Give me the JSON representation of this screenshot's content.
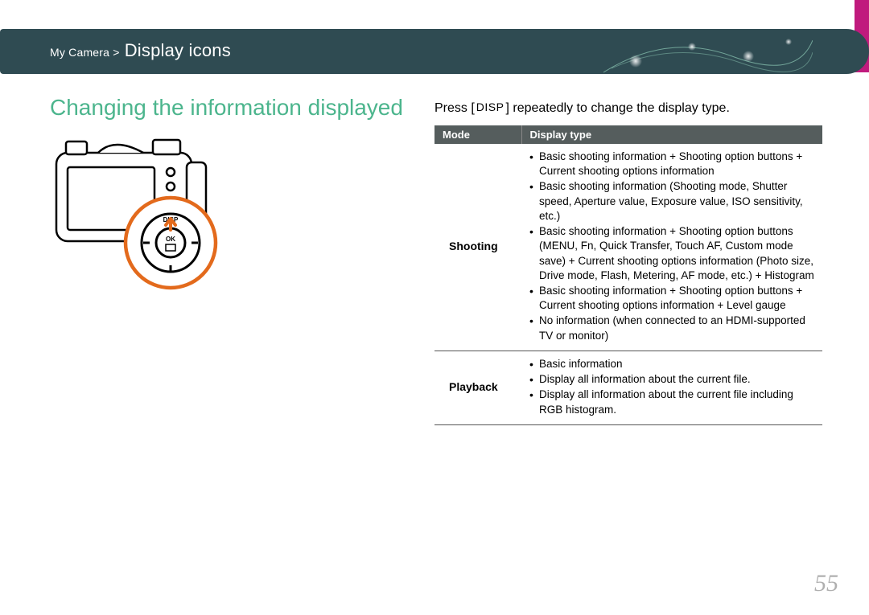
{
  "header": {
    "breadcrumb_prefix": "My Camera > ",
    "breadcrumb_current": "Display icons"
  },
  "section_title": "Changing the information displayed",
  "intro": {
    "prefix": "Press [",
    "button_label": "DISP",
    "suffix": "] repeatedly to change the display type."
  },
  "table": {
    "headers": {
      "mode": "Mode",
      "display_type": "Display type"
    },
    "rows": [
      {
        "mode": "Shooting",
        "items": [
          "Basic shooting information + Shooting option buttons + Current shooting options information",
          "Basic shooting information (Shooting mode, Shutter speed, Aperture value, Exposure value, ISO sensitivity, etc.)",
          "Basic shooting information + Shooting option buttons (MENU, Fn, Quick Transfer, Touch AF, Custom mode save) + Current shooting options information (Photo size, Drive mode, Flash, Metering, AF mode, etc.) + Histogram",
          "Basic shooting information + Shooting option buttons + Current shooting options information + Level gauge",
          "No information (when connected to an HDMI-supported TV or monitor)"
        ]
      },
      {
        "mode": "Playback",
        "items": [
          "Basic information",
          "Display all information about the current file.",
          "Display all information about the current file including RGB histogram."
        ]
      }
    ]
  },
  "page_number": "55"
}
